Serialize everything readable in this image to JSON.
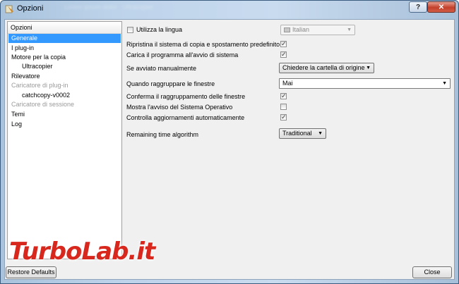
{
  "window": {
    "title": "Opzioni",
    "help_label": "?",
    "close_glyph": "✕",
    "background_tabs_text": "Lorem ipsum dolor · Ultracopier"
  },
  "tree": {
    "header": "Opzioni",
    "items": [
      {
        "label": "Generale",
        "level": 0,
        "selected": true,
        "disabled": false
      },
      {
        "label": "I plug-in",
        "level": 0,
        "selected": false,
        "disabled": false
      },
      {
        "label": "Motore per la copia",
        "level": 0,
        "selected": false,
        "disabled": false
      },
      {
        "label": "Ultracopier",
        "level": 1,
        "selected": false,
        "disabled": false
      },
      {
        "label": "Rilevatore",
        "level": 0,
        "selected": false,
        "disabled": false
      },
      {
        "label": "Caricatore di plug-in",
        "level": 0,
        "selected": false,
        "disabled": true
      },
      {
        "label": "catchcopy-v0002",
        "level": 1,
        "selected": false,
        "disabled": false
      },
      {
        "label": "Caricatore di sessione",
        "level": 0,
        "selected": false,
        "disabled": true
      },
      {
        "label": "Temi",
        "level": 0,
        "selected": false,
        "disabled": false
      },
      {
        "label": "Log",
        "level": 0,
        "selected": false,
        "disabled": false
      }
    ]
  },
  "settings": {
    "use_language": {
      "label": "Utilizza la lingua",
      "checked": false,
      "value": "Italian"
    },
    "restore_default": {
      "label": "Ripristina il sistema di copia e spostamento predefinito",
      "checked": true
    },
    "load_at_startup": {
      "label": "Carica il programma all'avvio di sistema",
      "checked": true
    },
    "manual_start": {
      "label": "Se avviato manualmente",
      "value": "Chiedere la cartella di origine"
    },
    "group_windows": {
      "label": "Quando raggruppare le finestre",
      "value": "Mai"
    },
    "confirm_grouping": {
      "label": "Conferma il raggruppamento delle finestre",
      "checked": true
    },
    "os_warning": {
      "label": "Mostra l'avviso del Sistema Operativo",
      "checked": false
    },
    "auto_update": {
      "label": "Controlla aggiornamenti automaticamente",
      "checked": true
    },
    "remaining_time": {
      "label": "Remaining time algorithm",
      "value": "Traditional"
    }
  },
  "footer": {
    "restore_defaults": "Restore Defaults",
    "close": "Close"
  },
  "watermark": {
    "text_a": "Turbo",
    "text_b": "Lab.it"
  },
  "icons": {
    "check": "✓",
    "dropdown": "▼",
    "app": "app-icon",
    "flag": "flag-icon"
  }
}
